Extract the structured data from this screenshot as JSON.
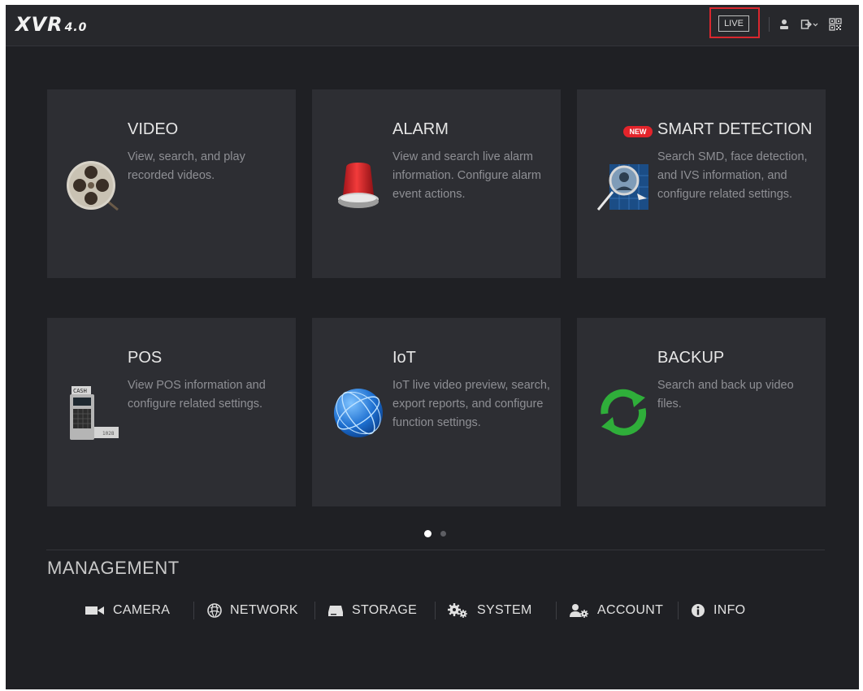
{
  "header": {
    "logo": "XVR",
    "version": "4.0",
    "live_label": "LIVE",
    "icons": [
      "user-icon",
      "logout-icon",
      "qr-code-icon"
    ]
  },
  "tiles": [
    {
      "title": "VIDEO",
      "desc": "View, search, and play recorded videos.",
      "icon": "film-reel-icon"
    },
    {
      "title": "ALARM",
      "desc": "View and search live alarm information. Configure alarm event actions.",
      "icon": "alarm-light-icon"
    },
    {
      "title": "SMART DETECTION",
      "badge": "NEW",
      "desc": "Search SMD, face detection, and IVS information, and configure related settings.",
      "icon": "magnifier-face-icon"
    },
    {
      "title": "POS",
      "desc": "View POS information and configure related settings.",
      "icon": "cash-register-icon"
    },
    {
      "title": "IoT",
      "desc": "IoT live video preview, search, export reports, and configure function settings.",
      "icon": "globe-icon"
    },
    {
      "title": "BACKUP",
      "desc": "Search and back up video files.",
      "icon": "refresh-arrows-icon"
    }
  ],
  "pagination": {
    "current": 1,
    "total": 2
  },
  "management": {
    "title": "MANAGEMENT",
    "items": [
      {
        "label": "CAMERA",
        "icon": "camera-icon"
      },
      {
        "label": "NETWORK",
        "icon": "network-icon"
      },
      {
        "label": "STORAGE",
        "icon": "storage-icon"
      },
      {
        "label": "SYSTEM",
        "icon": "gears-icon"
      },
      {
        "label": "ACCOUNT",
        "icon": "account-icon"
      },
      {
        "label": "INFO",
        "icon": "info-icon"
      }
    ]
  },
  "colors": {
    "background": "#1f2024",
    "tile": "#2d2e33",
    "highlight": "#d9272e",
    "badge": "#e3242b"
  }
}
